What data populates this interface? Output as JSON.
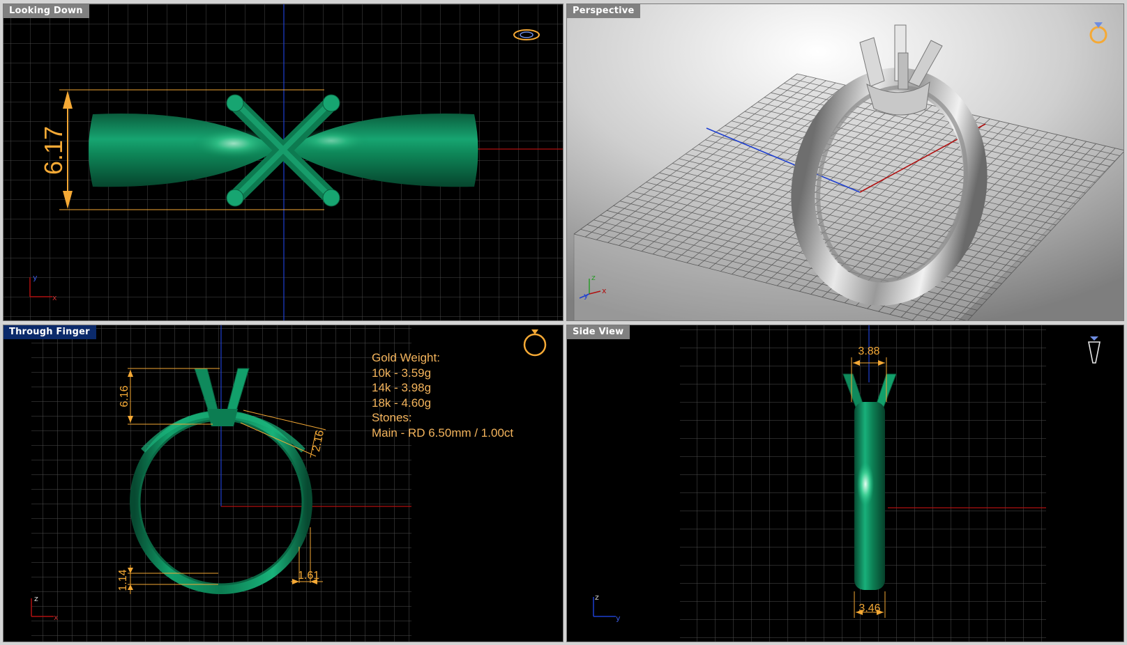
{
  "viewports": {
    "top": {
      "title": "Looking Down",
      "dimension": "6.17",
      "axis_x": "x",
      "axis_y": "y"
    },
    "perspective": {
      "title": "Perspective",
      "axis_x": "x",
      "axis_y": "y",
      "axis_z": "z"
    },
    "front": {
      "title": "Through Finger",
      "dimensions": {
        "head_height": "6.16",
        "shank_top": "2.16",
        "shank_bottom_height": "1.14",
        "shank_bottom_width": "1.61"
      },
      "info": {
        "gold_heading": "Gold Weight:",
        "gold_10k": "10k - 3.59g",
        "gold_14k": "14k - 3.98g",
        "gold_18k": "18k - 4.60g",
        "stones_heading": "Stones:",
        "stones_main": "Main - RD 6.50mm / 1.00ct"
      },
      "axis_x": "x",
      "axis_z": "z"
    },
    "side": {
      "title": "Side View",
      "dimension_top": "3.88",
      "dimension_bottom": "3.46",
      "axis_y": "y",
      "axis_z": "z"
    }
  },
  "colors": {
    "viewport_background": "#000000",
    "grid": "#5a5a5a",
    "grid_major": "#8a8a8a",
    "ring_green": "#0f8a5c",
    "dimension_orange": "#f5a935",
    "axis_red": "#b01010",
    "axis_blue": "#1e3fd0",
    "active_title": "#0b2a6b"
  }
}
